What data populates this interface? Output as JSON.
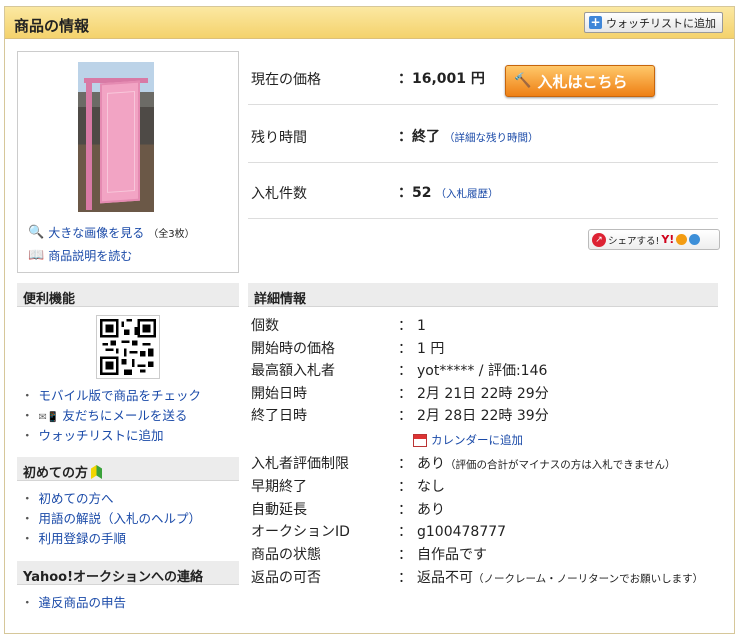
{
  "header": {
    "title": "商品の情報",
    "watchlist_button": "ウォッチリストに追加"
  },
  "images": {
    "large_image_link": "大きな画像を見る",
    "image_count": "（全3枚）",
    "read_description_link": "商品説明を読む"
  },
  "summary": {
    "price_label": "現在の価格",
    "price_value": "：16,001 円",
    "bid_button": "入札はこちら",
    "remaining_label": "残り時間",
    "remaining_value": "：終了",
    "remaining_link": "（詳細な残り時間）",
    "bids_label": "入札件数",
    "bids_value": "：52",
    "bids_link": "（入札履歴）",
    "share_label": "シェアする!"
  },
  "sidebar": {
    "convenience_title": "便利機能",
    "mobile_link": "モバイル版で商品をチェック",
    "mail_link": "友だちにメールを送る",
    "watch_link": "ウォッチリストに追加",
    "beginner_title": "初めての方",
    "beginner_links": [
      "初めての方へ",
      "用語の解説（入札のヘルプ）",
      "利用登録の手順"
    ],
    "contact_title": "Yahoo!オークションへの連絡",
    "report_link": "違反商品の申告"
  },
  "details": {
    "title": "詳細情報",
    "rows": [
      {
        "label": "個数",
        "value": "1"
      },
      {
        "label": "開始時の価格",
        "value": "1 円"
      },
      {
        "label": "最高額入札者",
        "value": "yot***** / 評価:146"
      },
      {
        "label": "開始日時",
        "value": "2月 21日 22時 29分"
      },
      {
        "label": "終了日時",
        "value": "2月 28日 22時 39分"
      },
      {
        "label": "入札者評価制限",
        "value": "あり",
        "note": "（評価の合計がマイナスの方は入札できません）"
      },
      {
        "label": "早期終了",
        "value": "なし"
      },
      {
        "label": "自動延長",
        "value": "あり"
      },
      {
        "label": "オークションID",
        "value": "g100478777"
      },
      {
        "label": "商品の状態",
        "value": "自作品です"
      },
      {
        "label": "返品の可否",
        "value": "返品不可",
        "note": "（ノークレーム・ノーリターンでお願いします）"
      }
    ],
    "calendar_link": "カレンダーに追加"
  },
  "icons": {
    "watch": "plus-icon",
    "magnifier": "magnifier-icon",
    "book": "book-icon",
    "mail": "mail-icon",
    "beginner": "beginner-mark-icon",
    "calendar": "calendar-icon",
    "hammer": "hammer-icon"
  },
  "colors": {
    "header_bg": "#f4d26c",
    "bid_button": "#ee7f14",
    "link": "#1a4aa8"
  }
}
